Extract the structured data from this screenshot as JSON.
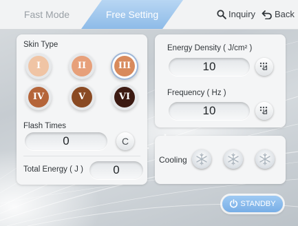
{
  "tabs": [
    {
      "label": "Fast Mode",
      "active": false
    },
    {
      "label": "Free Setting",
      "active": true
    }
  ],
  "top_actions": {
    "inquiry": "Inquiry",
    "back": "Back"
  },
  "skin": {
    "title": "Skin Type",
    "types": [
      {
        "label": "I",
        "color": "#f0c4a4"
      },
      {
        "label": "II",
        "color": "#e7a07a"
      },
      {
        "label": "III",
        "color": "#d88a5c",
        "selected": true
      },
      {
        "label": "IV",
        "color": "#b5653a"
      },
      {
        "label": "V",
        "color": "#8a4a23"
      },
      {
        "label": "VI",
        "color": "#3c1a12"
      }
    ]
  },
  "flash": {
    "title": "Flash Times",
    "value": "0",
    "clear_label": "C"
  },
  "total_energy": {
    "label": "Total Energy ( J )",
    "value": "0"
  },
  "energy_density": {
    "label": "Energy Density ( J/cm² )",
    "value": "10",
    "icon": "touch-keypad-icon"
  },
  "frequency": {
    "label": "Frequency ( Hz )",
    "value": "10",
    "icon": "touch-keypad-icon"
  },
  "cooling": {
    "label": "Cooling",
    "levels": 3,
    "icon": "snowflake-icon"
  },
  "standby": {
    "label": "STANDBY",
    "icon": "power-icon"
  },
  "colors": {
    "accent": "#8ebbe8",
    "panel": "#f4f5f6"
  }
}
